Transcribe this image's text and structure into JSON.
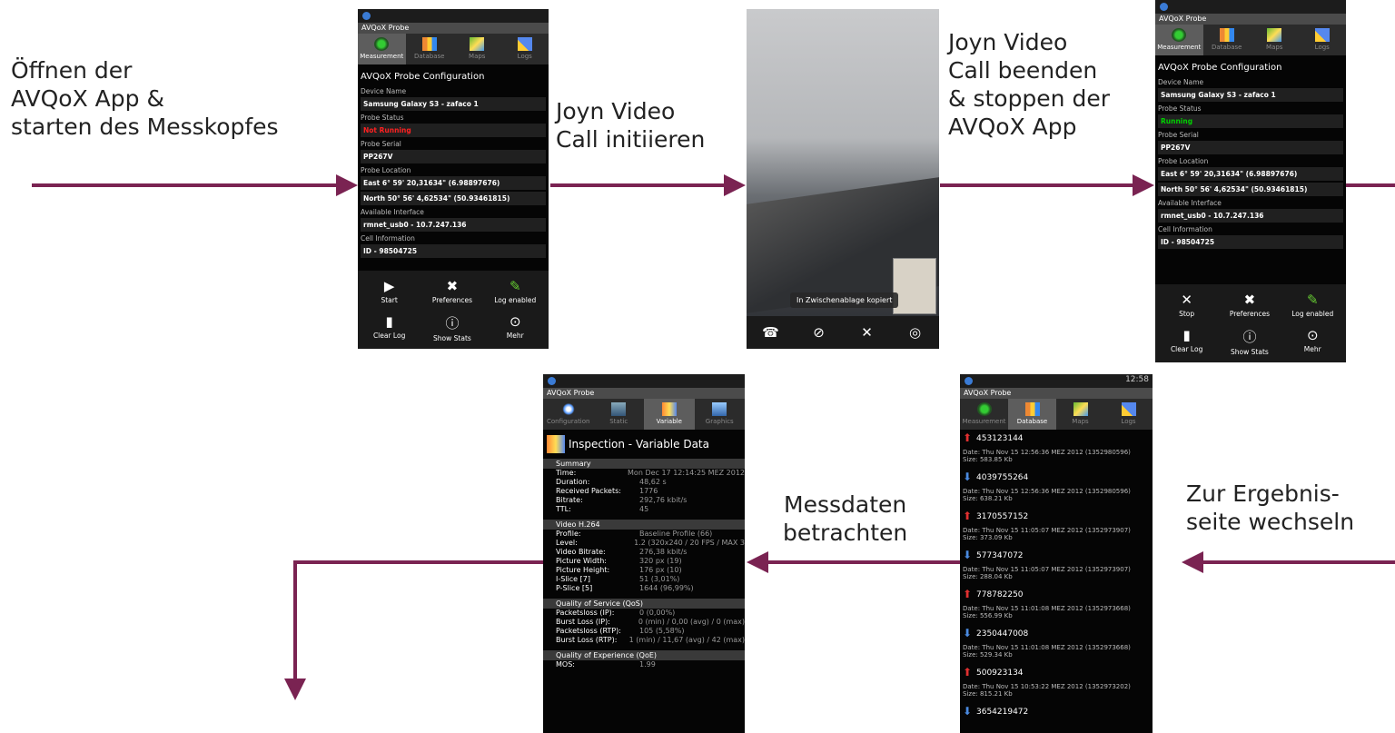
{
  "labels": {
    "step1": "Öffnen der\nAVQoX App &\nstarten des Messkopfes",
    "step2": "Joyn Video\nCall initiieren",
    "step3": "Joyn Video\nCall beenden\n& stoppen der\nAVQoX App",
    "step4": "Zur Ergebnis-\nseite wechseln",
    "step5": "Messdaten\nbetrachten"
  },
  "colors": {
    "arrow": "#7a2352",
    "running": "#00d000",
    "not_running": "#ff2020",
    "arrow_up": "#e03030",
    "arrow_down": "#4a8ae0"
  },
  "app": {
    "title": "AVQoX Probe",
    "tabs": [
      "Measurement",
      "Database",
      "Maps",
      "Logs"
    ],
    "config_title": "AVQoX Probe Configuration",
    "fields": {
      "device_label": "Device Name",
      "device": "Samsung Galaxy S3 - zafaco 1",
      "status_label": "Probe Status",
      "status_off": "Not Running",
      "status_on": "Running",
      "serial_label": "Probe Serial",
      "serial": "PP267V",
      "location_label": "Probe Location",
      "east": "East 6° 59' 20,31634\" (6.98897676)",
      "north": "North 50° 56' 4,62534\" (50.93461815)",
      "iface_label": "Available Interface",
      "iface": "rmnet_usb0 - 10.7.247.136",
      "cell_label": "Cell Information",
      "cell_id": "ID - 98504725"
    },
    "menu": {
      "start": "Start",
      "stop": "Stop",
      "prefs": "Preferences",
      "log": "Log enabled",
      "clear": "Clear Log",
      "stats": "Show Stats",
      "more": "Mehr"
    },
    "status_time": "12:58"
  },
  "video": {
    "toast": "In Zwischenablage kopiert"
  },
  "database": {
    "items": [
      {
        "dir": "up",
        "id": "453123144",
        "date": "Date: Thu Nov 15 12:56:36 MEZ 2012 (1352980596)",
        "size": "Size: 583.85 Kb"
      },
      {
        "dir": "down",
        "id": "4039755264",
        "date": "Date: Thu Nov 15 12:56:36 MEZ 2012 (1352980596)",
        "size": "Size: 638.21 Kb"
      },
      {
        "dir": "up",
        "id": "3170557152",
        "date": "Date: Thu Nov 15 11:05:07 MEZ 2012 (1352973907)",
        "size": "Size: 373.09 Kb"
      },
      {
        "dir": "down",
        "id": "577347072",
        "date": "Date: Thu Nov 15 11:05:07 MEZ 2012 (1352973907)",
        "size": "Size: 288.04 Kb"
      },
      {
        "dir": "up",
        "id": "778782250",
        "date": "Date: Thu Nov 15 11:01:08 MEZ 2012 (1352973668)",
        "size": "Size: 556.99 Kb"
      },
      {
        "dir": "down",
        "id": "2350447008",
        "date": "Date: Thu Nov 15 11:01:08 MEZ 2012 (1352973668)",
        "size": "Size: 529.34 Kb"
      },
      {
        "dir": "up",
        "id": "500923134",
        "date": "Date: Thu Nov 15 10:53:22 MEZ 2012 (1352973202)",
        "size": "Size: 815.21 Kb"
      },
      {
        "dir": "down",
        "id": "3654219472",
        "date": "",
        "size": ""
      }
    ]
  },
  "inspection": {
    "tabs": [
      "Configuration",
      "Static",
      "Variable",
      "Graphics"
    ],
    "title": "Inspection - Variable Data",
    "sections": [
      {
        "name": "Summary",
        "rows": [
          [
            "Time:",
            "Mon Dec 17 12:14:25 MEZ 2012"
          ],
          [
            "Duration:",
            "48,62 s"
          ],
          [
            "Received Packets:",
            "1776"
          ],
          [
            "Bitrate:",
            "292,76 kbit/s"
          ],
          [
            "TTL:",
            "45"
          ]
        ]
      },
      {
        "name": "Video H.264",
        "rows": [
          [
            "Profile:",
            "Baseline Profile (66)"
          ],
          [
            "Level:",
            "1.2 (320x240 / 20 FPS / MAX 3"
          ],
          [
            "Video Bitrate:",
            "276,38 kbit/s"
          ],
          [
            "Picture Width:",
            "320 px (19)"
          ],
          [
            "Picture Height:",
            "176 px (10)"
          ],
          [
            "I-Slice [7]",
            "51 (3,01%)"
          ],
          [
            "P-Slice [5]",
            "1644 (96,99%)"
          ]
        ]
      },
      {
        "name": "Quality of Service (QoS)",
        "rows": [
          [
            "Packetsloss (IP):",
            "0 (0,00%)"
          ],
          [
            "Burst Loss (IP):",
            "0 (min) / 0,00 (avg) / 0 (max)"
          ],
          [
            "Packetsloss (RTP):",
            "105 (5,58%)"
          ],
          [
            "Burst Loss (RTP):",
            "1 (min) / 11,67 (avg) / 42 (max)"
          ]
        ]
      },
      {
        "name": "Quality of Experience (QoE)",
        "rows": [
          [
            "MOS:",
            "1.99"
          ]
        ]
      }
    ]
  }
}
